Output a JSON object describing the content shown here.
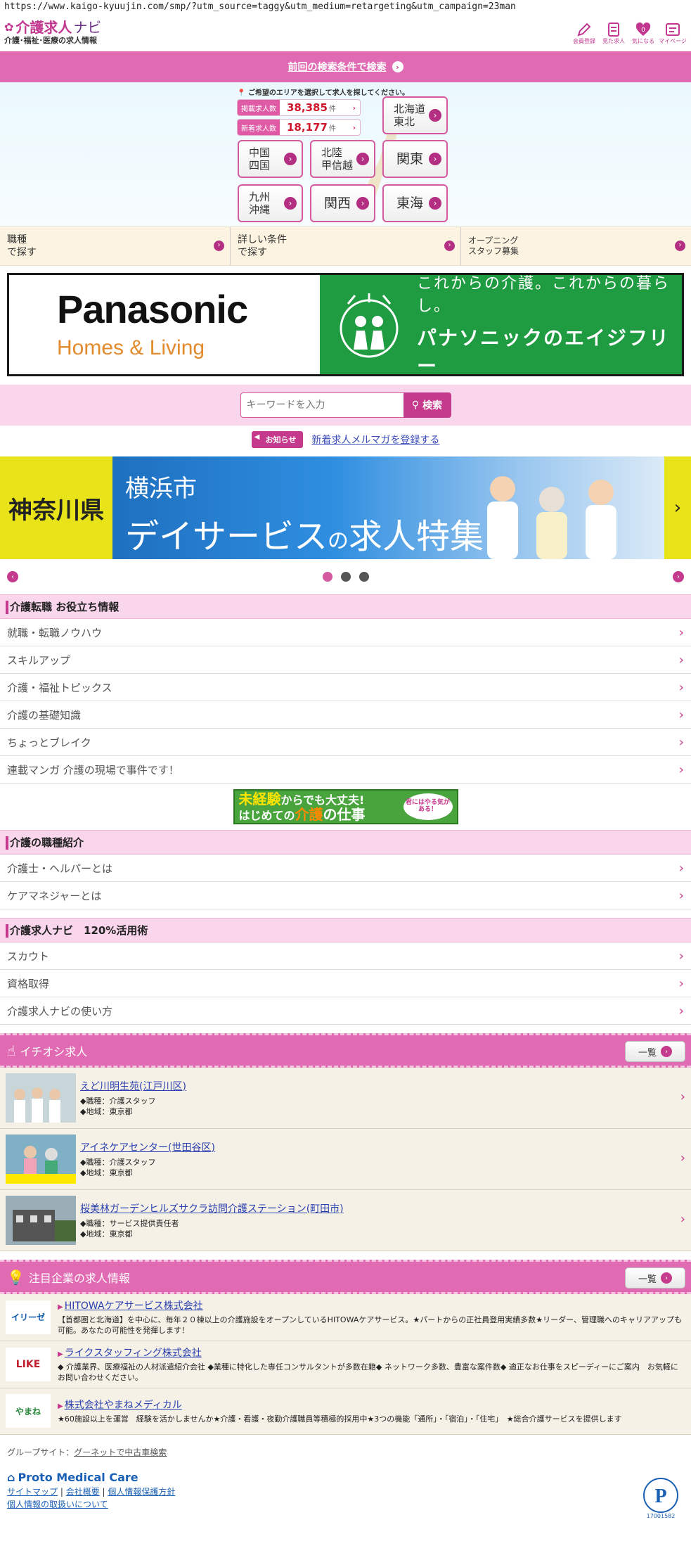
{
  "browser": {
    "url": "https://www.kaigo-kyuujin.com/smp/?utm_source=taggy&utm_medium=retargeting&utm_campaign=23man"
  },
  "header": {
    "logo_main": "介護求人",
    "logo_navi": "ナビ",
    "logo_sub": "介護･福祉･医療の求人情報",
    "icons": [
      {
        "label": "会員登録",
        "icon": "pencil-icon"
      },
      {
        "label": "見た求人",
        "icon": "list-icon"
      },
      {
        "label": "気になる",
        "icon": "heart-icon",
        "badge": "0"
      },
      {
        "label": "マイページ",
        "icon": "mypage-icon"
      }
    ]
  },
  "prev_search": {
    "label": "前回の検索条件で検索"
  },
  "area": {
    "hint": "ご希望のエリアを選択して求人を探してください。",
    "stats": [
      {
        "label": "掲載求人数",
        "value": "38,385",
        "unit": "件"
      },
      {
        "label": "新着求人数",
        "value": "18,177",
        "unit": "件"
      }
    ],
    "regions": [
      "北海道\n東北",
      "中国\n四国",
      "北陸\n甲信越",
      "関東",
      "九州\n沖縄",
      "関西",
      "東海"
    ]
  },
  "search_links": [
    {
      "label": "職種\nで探す"
    },
    {
      "label": "詳しい条件\nで探す"
    },
    {
      "label": "オープニング\nスタッフ募集"
    }
  ],
  "panasonic": {
    "logo": "Panasonic",
    "sub": "Homes & Living",
    "tag1": "これからの介護。これからの暮らし。",
    "tag2": "パナソニックのエイジフリー"
  },
  "keyword": {
    "placeholder": "キーワードを入力",
    "button": "検索"
  },
  "notice": {
    "badge": "お知らせ",
    "link": "新着求人メルマガを登録する"
  },
  "slider": {
    "left": "神奈川県",
    "title1": "横浜市",
    "title2a": "デイサービス",
    "title2b": "の",
    "title2c": "求人特集",
    "dots": 3,
    "active": 0
  },
  "sections": [
    {
      "title": "介護転職 お役立ち情報",
      "items": [
        "就職・転職ノウハウ",
        "スキルアップ",
        "介護・福祉トピックス",
        "介護の基礎知識",
        "ちょっとブレイク",
        "連載マンガ 介護の現場で事件です！"
      ]
    },
    {
      "title": "介護の職種紹介",
      "items": [
        "介護士・ヘルパーとは",
        "ケアマネジャーとは"
      ]
    },
    {
      "title": "介護求人ナビ　120%活用術",
      "items": [
        "スカウト",
        "資格取得",
        "介護求人ナビの使い方"
      ]
    }
  ],
  "mid_banner": {
    "a": "未経験",
    "b": "からでも大丈夫!",
    "c": "はじめての",
    "d": "介護",
    "e": "の仕事",
    "badge": "君にはやる気がある！"
  },
  "ichioshi": {
    "title": "イチオシ求人",
    "all": "一覧",
    "jobs": [
      {
        "title": "えど川明生苑(江戸川区)",
        "lines": [
          "◆職種：介護スタッフ",
          "◆地域：東京都"
        ]
      },
      {
        "title": "アイネケアセンター(世田谷区)",
        "lines": [
          "◆職種：介護スタッフ",
          "◆地域：東京都"
        ]
      },
      {
        "title": "桜美林ガーデンヒルズサクラ訪問介護ステーション(町田市)",
        "lines": [
          "◆職種：サービス提供責任者",
          "◆地域：東京都"
        ]
      }
    ]
  },
  "companies": {
    "title": "注目企業の求人情報",
    "all": "一覧",
    "items": [
      {
        "logo": "イリーゼ",
        "name": "HITOWAケアサービス株式会社",
        "desc": "【首都圏と北海道】を中心に、毎年２０棟以上の介護施設をオープンしているHITOWAケアサービス。★パートからの正社員登用実績多数★リーダー、管理職へのキャリアアップも可能。あなたの可能性を発揮します！"
      },
      {
        "logo": "LIKE",
        "name": "ライクスタッフィング株式会社",
        "desc": "◆ 介護業界、医療福祉の人材派遣紹介会社 ◆業種に特化した専任コンサルタントが多数在籍◆ ネットワーク多数、豊富な案件数◆ 適正なお仕事をスピーディーにご案内　お気軽にお問い合わせください。"
      },
      {
        "logo": "やまね",
        "name": "株式会社やまねメディカル",
        "desc": "★60施設以上を運営　経験を活かしませんか★介護・看護・夜勤介護職員等積極的採用中★3つの機能「通所」・「宿泊」・「住宅」　★総合介護サービスを提供します"
      }
    ]
  },
  "footer": {
    "group_label": "グループサイト：",
    "group_link": "グーネットで中古車検索",
    "brand": "Proto Medical Care",
    "links": [
      "サイトマップ",
      "会社概要",
      "個人情報保護方針",
      "個人情報の取扱いについて"
    ],
    "privacy_num": "17001582"
  }
}
